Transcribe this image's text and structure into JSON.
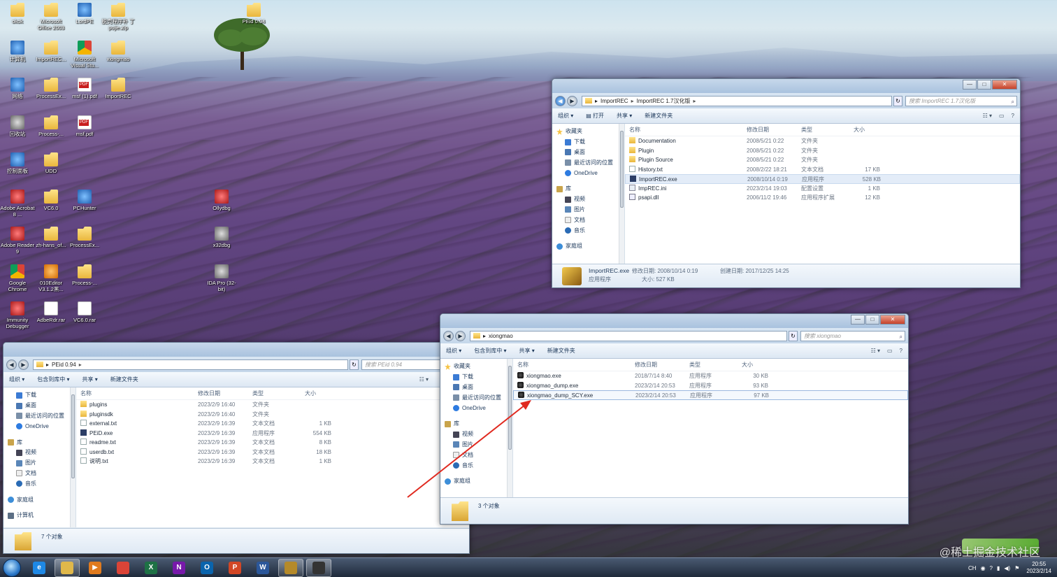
{
  "desktop": {
    "icons": [
      {
        "label": "okok",
        "glyph": "folder-icon"
      },
      {
        "label": "Microsoft Office 2003",
        "glyph": "folder-icon"
      },
      {
        "label": "LordPE",
        "glyph": "lordpe-icon"
      },
      {
        "label": "脱壳程序补 丁 pojie.zip",
        "glyph": "zip-icon"
      },
      {
        "label": "PEid 0.94",
        "glyph": "folder-icon"
      },
      {
        "label": "计算机",
        "glyph": "computer-icon"
      },
      {
        "label": "ImportREC...",
        "glyph": "folder-icon"
      },
      {
        "label": "Microsoft Visual Stu...",
        "glyph": "vs-icon"
      },
      {
        "label": "xiongmao",
        "glyph": "folder-icon"
      },
      {
        "label": "网络",
        "glyph": "network-icon"
      },
      {
        "label": "ProcessEx...",
        "glyph": "folder-icon"
      },
      {
        "label": "msf (1).pdf",
        "glyph": "pdf-icon"
      },
      {
        "label": "ImportREC",
        "glyph": "folder-icon"
      },
      {
        "label": "回收站",
        "glyph": "recycle-bin-icon"
      },
      {
        "label": "Process-...",
        "glyph": "folder-icon"
      },
      {
        "label": "msf.pdf",
        "glyph": "pdf-icon"
      },
      {
        "label": "控制面板",
        "glyph": "control-panel-icon"
      },
      {
        "label": "UDD",
        "glyph": "folder-icon"
      },
      {
        "label": "Adobe Acrobat 8 ...",
        "glyph": "acrobat-icon"
      },
      {
        "label": "VC6.0",
        "glyph": "folder-icon"
      },
      {
        "label": "PCHunter",
        "glyph": "pchunter-icon"
      },
      {
        "label": "Ollydbg",
        "glyph": "ollydbg-icon"
      },
      {
        "label": "Adobe Reader 9",
        "glyph": "reader-icon"
      },
      {
        "label": "zh-hans_of...",
        "glyph": "folder-icon"
      },
      {
        "label": "ProcessEx...",
        "glyph": "folder-icon"
      },
      {
        "label": "x32dbg",
        "glyph": "x32dbg-icon"
      },
      {
        "label": "Google Chrome",
        "glyph": "chrome-icon"
      },
      {
        "label": "010Editor V3.1.2黑...",
        "glyph": "editor-icon"
      },
      {
        "label": "Process-...",
        "glyph": "folder-icon"
      },
      {
        "label": "IDA Pro (32-bit)",
        "glyph": "ida-icon"
      },
      {
        "label": "Immunity Debugger",
        "glyph": "immunity-icon"
      },
      {
        "label": "AdbeRdr.rar",
        "glyph": "rar-icon"
      },
      {
        "label": "VC6.0.rar",
        "glyph": "rar-icon"
      }
    ]
  },
  "common": {
    "organize": "组织 ▾",
    "include_library": "包含到库中 ▾",
    "share": "共享 ▾",
    "new_folder": "新建文件夹",
    "open": "打开",
    "col_name": "名称",
    "col_date": "修改日期",
    "col_type": "类型",
    "col_size": "大小",
    "nav": {
      "favorites": "收藏夹",
      "downloads": "下载",
      "desktop": "桌面",
      "recent": "最近访问的位置",
      "onedrive": "OneDrive",
      "libraries": "库",
      "videos": "视频",
      "pictures": "图片",
      "documents": "文档",
      "music": "音乐",
      "homegroup": "家庭组",
      "computer": "计算机"
    }
  },
  "window_importrec": {
    "path_root": "ImportREC",
    "path_leaf": "ImportREC 1.7汉化版",
    "search_placeholder": "搜索 ImportREC 1.7汉化版",
    "files": [
      {
        "name": "Documentation",
        "date": "2008/5/21 0:22",
        "type": "文件夹",
        "size": "",
        "icon": "folder"
      },
      {
        "name": "Plugin",
        "date": "2008/5/21 0:22",
        "type": "文件夹",
        "size": "",
        "icon": "folder"
      },
      {
        "name": "Plugin Source",
        "date": "2008/5/21 0:22",
        "type": "文件夹",
        "size": "",
        "icon": "folder"
      },
      {
        "name": "History.txt",
        "date": "2008/2/22 18:21",
        "type": "文本文档",
        "size": "17 KB",
        "icon": "txt"
      },
      {
        "name": "ImportREC.exe",
        "date": "2008/10/14 0:19",
        "type": "应用程序",
        "size": "528 KB",
        "icon": "exe"
      },
      {
        "name": "ImpREC.ini",
        "date": "2023/2/14 19:03",
        "type": "配置设置",
        "size": "1 KB",
        "icon": "ini"
      },
      {
        "name": "psapi.dll",
        "date": "2006/11/2 19:46",
        "type": "应用程序扩展",
        "size": "12 KB",
        "icon": "dll"
      }
    ],
    "details": {
      "name": "ImportREC.exe",
      "modified_label": "修改日期: 2008/10/14 0:19",
      "created_label": "创建日期: 2017/12/25 14:25",
      "type": "应用程序",
      "size_label": "大小: 527 KB"
    }
  },
  "window_peid": {
    "path_leaf": "PEid 0.94",
    "search_placeholder": "搜索 PEid 0.94",
    "files": [
      {
        "name": "plugins",
        "date": "2023/2/9 16:40",
        "type": "文件夹",
        "size": "",
        "icon": "folder"
      },
      {
        "name": "pluginsdk",
        "date": "2023/2/9 16:40",
        "type": "文件夹",
        "size": "",
        "icon": "folder"
      },
      {
        "name": "external.txt",
        "date": "2023/2/9 16:39",
        "type": "文本文档",
        "size": "1 KB",
        "icon": "txt"
      },
      {
        "name": "PEiD.exe",
        "date": "2023/2/9 16:39",
        "type": "应用程序",
        "size": "554 KB",
        "icon": "exe"
      },
      {
        "name": "readme.txt",
        "date": "2023/2/9 16:39",
        "type": "文本文档",
        "size": "8 KB",
        "icon": "txt"
      },
      {
        "name": "userdb.txt",
        "date": "2023/2/9 16:39",
        "type": "文本文档",
        "size": "18 KB",
        "icon": "txt"
      },
      {
        "name": "说明.txt",
        "date": "2023/2/9 16:39",
        "type": "文本文档",
        "size": "1 KB",
        "icon": "txt"
      }
    ],
    "status": "7 个对象"
  },
  "window_xiongmao": {
    "path_leaf": "xiongmao",
    "search_placeholder": "搜索 xiongmao",
    "files": [
      {
        "name": "xiongmao.exe",
        "date": "2018/7/14 8:40",
        "type": "应用程序",
        "size": "30 KB",
        "icon": "bug"
      },
      {
        "name": "xiongmao_dump.exe",
        "date": "2023/2/14 20:53",
        "type": "应用程序",
        "size": "93 KB",
        "icon": "bug"
      },
      {
        "name": "xiongmao_dump_SCY.exe",
        "date": "2023/2/14 20:53",
        "type": "应用程序",
        "size": "97 KB",
        "icon": "bug"
      }
    ],
    "status": "3 个对象"
  },
  "taskbar": {
    "apps": [
      {
        "name": "ie-icon",
        "letter": "e",
        "color": "#1e88e5"
      },
      {
        "name": "explorer-icon",
        "letter": "",
        "color": "#e0b84a"
      },
      {
        "name": "media-player-icon",
        "letter": "▶",
        "color": "#e07b1f"
      },
      {
        "name": "chrome-taskbar-icon",
        "letter": "",
        "color": "#db4437"
      },
      {
        "name": "excel-icon",
        "letter": "X",
        "color": "#1e7145"
      },
      {
        "name": "onenote-icon",
        "letter": "N",
        "color": "#7719aa"
      },
      {
        "name": "outlook-icon",
        "letter": "O",
        "color": "#0a64ad"
      },
      {
        "name": "powerpoint-icon",
        "letter": "P",
        "color": "#d24726"
      },
      {
        "name": "word-icon",
        "letter": "W",
        "color": "#2b579a"
      },
      {
        "name": "importrec-taskbar-icon",
        "letter": "",
        "color": "#b58a2a"
      },
      {
        "name": "debugger-taskbar-icon",
        "letter": "",
        "color": "#333333"
      }
    ],
    "lang": "CH",
    "time": "20:55",
    "date": "2023/2/14"
  },
  "watermark": "@稀土掘金技术社区",
  "colors": {
    "accent": "#3a6ea5",
    "arrow": "#e0291f"
  }
}
